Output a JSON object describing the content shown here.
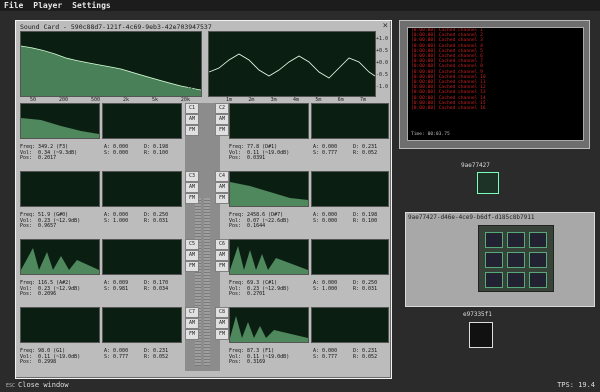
{
  "menu": {
    "items": [
      "File",
      "Player",
      "Settings"
    ]
  },
  "soundcard": {
    "title": "Sound Card - 590c88d7-121f-4c69-9eb3-42e703947537",
    "db_labels": [
      "0",
      "-20",
      "-40",
      "-60",
      "-80",
      "-100",
      "-120",
      "-140"
    ],
    "amp_labels": [
      "+1.0",
      "+0.5",
      "+0.0",
      "-0.5",
      "-1.0"
    ],
    "freq_labels": [
      "50",
      "200",
      "500",
      "2k",
      "5k",
      "20k"
    ],
    "time_labels": [
      "1m",
      "2m",
      "3m",
      "4m",
      "5m",
      "6m",
      "7m"
    ],
    "channels": [
      {
        "id": "C1",
        "freq": "Freq: 349.2 (F3)",
        "vol": "Vol:  0.34 (~9.3dB)",
        "pos": "Pos:  0.2017",
        "a": "A: 0.000",
        "s": "S: 0.000",
        "d": "D: 0.198",
        "r": "R: 0.100"
      },
      {
        "id": "C2",
        "freq": "Freq: 77.8 (D#1)",
        "vol": "Vol:  0.11 (~19.0dB)",
        "pos": "Pos:  0.0391",
        "a": "A: 0.000",
        "s": "S: 0.777",
        "d": "D: 0.231",
        "r": "R: 0.052"
      },
      {
        "id": "C3",
        "freq": "Freq: 51.9 (G#0)",
        "vol": "Vol:  0.23 (~12.9dB)",
        "pos": "Pos:  0.9657",
        "a": "A: 0.000",
        "s": "S: 1.000",
        "d": "D: 0.250",
        "r": "R: 0.031"
      },
      {
        "id": "C4",
        "freq": "Freq: 2458.6 (D#7)",
        "vol": "Vol:  0.07 (~22.6dB)",
        "pos": "Pos:  0.1644",
        "a": "A: 0.000",
        "s": "S: 0.000",
        "d": "D: 0.198",
        "r": "R: 0.100"
      },
      {
        "id": "C5",
        "freq": "Freq: 116.5 (A#2)",
        "vol": "Vol:  0.23 (~12.9dB)",
        "pos": "Pos:  0.2096",
        "a": "A: 0.009",
        "s": "S: 0.981",
        "d": "D: 0.170",
        "r": "R: 0.034"
      },
      {
        "id": "C6",
        "freq": "Freq: 69.3 (C#1)",
        "vol": "Vol:  0.23 (~12.9dB)",
        "pos": "Pos:  0.2701",
        "a": "A: 0.000",
        "s": "S: 1.000",
        "d": "D: 0.250",
        "r": "R: 0.031"
      },
      {
        "id": "C7",
        "freq": "Freq: 98.0 (G1)",
        "vol": "Vol:  0.11 (~19.0dB)",
        "pos": "Pos:  0.2998",
        "a": "A: 0.000",
        "s": "S: 0.777",
        "d": "D: 0.231",
        "r": "R: 0.052"
      },
      {
        "id": "C8",
        "freq": "Freq: 87.3 (F1)",
        "vol": "Vol:  0.11 (~19.0dB)",
        "pos": "Pos:  0.3169",
        "a": "A: 0.000",
        "s": "S: 0.777",
        "d": "D: 0.231",
        "r": "R: 0.052"
      }
    ],
    "chip_labels": [
      "AM",
      "FM"
    ]
  },
  "console": {
    "lines": [
      "[0:00:00] Cached channel 1",
      "[0:00:00] Cached channel 2",
      "[0:00:00] Cached channel 3",
      "[0:00:00] Cached channel 4",
      "[0:00:00] Cached channel 5",
      "[0:00:00] Cached channel 6",
      "[0:00:00] Cached channel 7",
      "[0:00:00] Cached channel 8",
      "[0:00:00] Cached channel 9",
      "[0:00:00] Cached channel 10",
      "[0:00:00] Cached channel 11",
      "[0:00:00] Cached channel 12",
      "[0:00:00] Cached channel 13",
      "[0:00:00] Cached channel 14",
      "[0:00:00] Cached channel 15",
      "[0:00:00] Cached channel 16"
    ],
    "timestamp": "Time: 00:03.75"
  },
  "nodes": {
    "node1_id": "9ae77427",
    "network_title": "9ae77427-d46e-4ce9-b6df-d185c8b7911",
    "node2_id": "e97335f1"
  },
  "status": {
    "key": "ESC",
    "action": "Close window",
    "tps": "TPS: 19.4"
  },
  "colors": {
    "scope_bg": "#0a1f12",
    "trace": "#c8f0c8",
    "fill": "#7fcf8f",
    "console_text": "#cc2222"
  }
}
